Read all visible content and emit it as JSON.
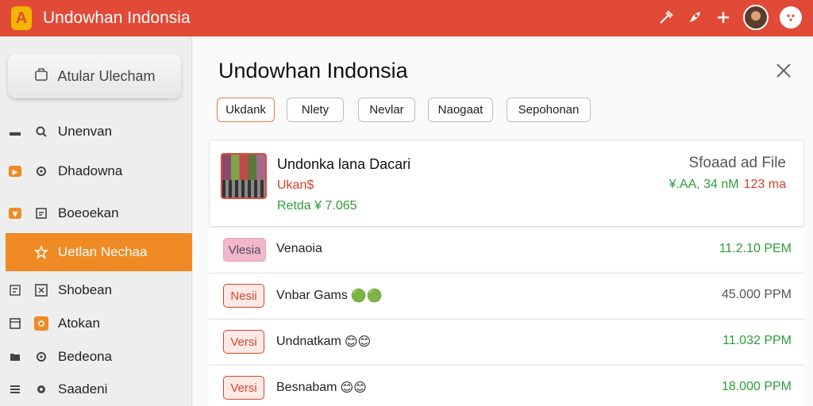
{
  "app": {
    "logo_letter": "A",
    "title": "Undowhan Indonsia"
  },
  "topbar": {
    "icons": [
      "tool-icon",
      "rocket-icon",
      "plus-icon",
      "avatar",
      "dots-icon"
    ]
  },
  "sidebar": {
    "primary_button_label": "Atular Ulecham",
    "items": [
      {
        "label": "Unenvan",
        "active": false
      },
      {
        "label": "Dhadowna",
        "active": false
      },
      {
        "label": "Boeoekan",
        "active": false
      },
      {
        "label": "Uetlan Nechaa",
        "active": true
      },
      {
        "label": "Shobean",
        "active": false
      },
      {
        "label": "Atokan",
        "active": false
      },
      {
        "label": "Bedeona",
        "active": false
      },
      {
        "label": "Saadeni",
        "active": false
      }
    ]
  },
  "main": {
    "title": "Undowhan Indonsia",
    "tabs": [
      {
        "label": "Ukdank",
        "active": true
      },
      {
        "label": "Nlety",
        "active": false
      },
      {
        "label": "Nevlar",
        "active": false
      },
      {
        "label": "Naogaat",
        "active": false
      },
      {
        "label": "Sepohonan",
        "active": false
      }
    ],
    "card": {
      "title": "Undonka lana Dacari",
      "subtitle": "Ukan$",
      "price": "Retda ¥ 7.065",
      "right_title": "Sfoaad ad File",
      "meta_green": "¥.AA, 34 nM",
      "meta_red": "123 ma"
    },
    "rows": [
      {
        "badge": "Vlesia",
        "badge_style": "pink",
        "name": "Venaoia",
        "emoji": "",
        "value": "11.2.10 PEM",
        "value_color": "green"
      },
      {
        "badge": "Nesii",
        "badge_style": "red",
        "name": "Vnbar Gams",
        "emoji": "🟢🟢",
        "value": "45.000 PPM",
        "value_color": "gray"
      },
      {
        "badge": "Versi",
        "badge_style": "red",
        "name": "Undnatkam",
        "emoji": "😊😊",
        "value": "11.032 PPM",
        "value_color": "green"
      },
      {
        "badge": "Versi",
        "badge_style": "red",
        "name": "Besnabam",
        "emoji": "😊😊",
        "value": "18.000 PPM",
        "value_color": "green"
      }
    ]
  }
}
